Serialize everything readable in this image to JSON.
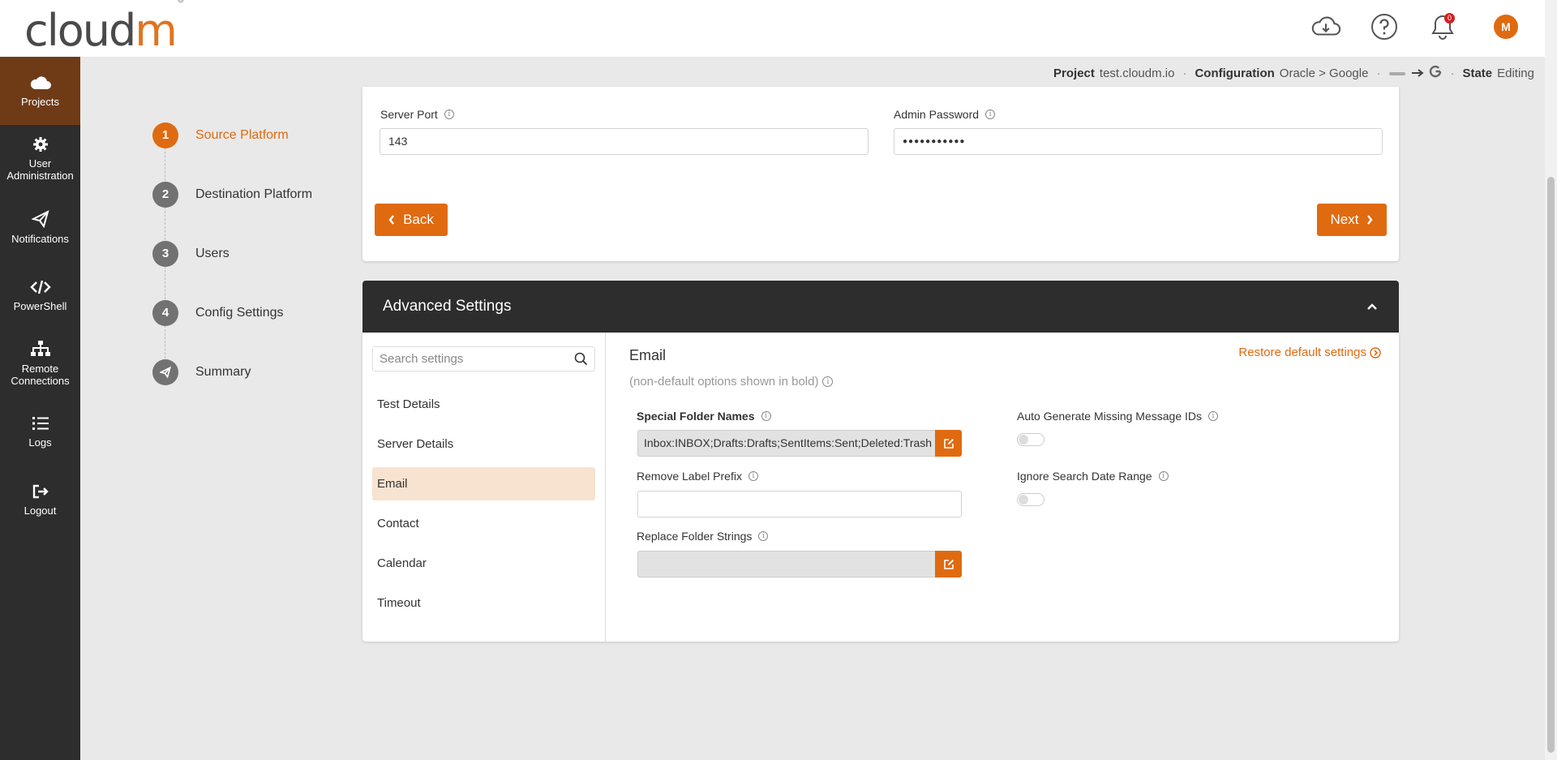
{
  "brand": {
    "logo_main": "cloud",
    "logo_accent": "m",
    "logo_mark": "®"
  },
  "topbar": {
    "notification_count": "0",
    "avatar_initial": "M"
  },
  "sidebar": {
    "items": [
      {
        "label": "Projects",
        "icon": "cloud-icon"
      },
      {
        "label": "User Administration",
        "icon": "gear-icon"
      },
      {
        "label": "Notifications",
        "icon": "paper-plane-icon"
      },
      {
        "label": "PowerShell",
        "icon": "code-icon"
      },
      {
        "label": "Remote Connections",
        "icon": "sitemap-icon"
      },
      {
        "label": "Logs",
        "icon": "list-icon"
      },
      {
        "label": "Logout",
        "icon": "logout-icon"
      }
    ]
  },
  "status": {
    "project_label": "Project",
    "project_value": "test.cloudm.io",
    "config_label": "Configuration",
    "config_value": "Oracle > Google",
    "state_label": "State",
    "state_value": "Editing"
  },
  "stepper": {
    "steps": [
      {
        "num": "1",
        "label": "Source Platform"
      },
      {
        "num": "2",
        "label": "Destination Platform"
      },
      {
        "num": "3",
        "label": "Users"
      },
      {
        "num": "4",
        "label": "Config Settings"
      },
      {
        "num": "",
        "label": "Summary"
      }
    ]
  },
  "server": {
    "port_label": "Server Port",
    "port_value": "143",
    "password_label": "Admin Password",
    "password_value": "●●●●●●●●●●●",
    "back_label": "Back",
    "next_label": "Next"
  },
  "advanced": {
    "title": "Advanced Settings",
    "search_placeholder": "Search settings",
    "categories": [
      "Test Details",
      "Server Details",
      "Email",
      "Contact",
      "Calendar",
      "Timeout"
    ],
    "active_category": "Email",
    "section_title": "Email",
    "restore_label": "Restore default settings",
    "note": "(non-default options shown in bold)",
    "special_folder_label": "Special Folder Names",
    "special_folder_value": "Inbox:INBOX;Drafts:Drafts;SentItems:Sent;Deleted:Trash",
    "remove_label_prefix_label": "Remove Label Prefix",
    "remove_label_prefix_value": "",
    "replace_folder_label": "Replace Folder Strings",
    "replace_folder_value": "",
    "auto_generate_label": "Auto Generate Missing Message IDs",
    "auto_generate_value": false,
    "ignore_search_label": "Ignore Search Date Range",
    "ignore_search_value": false
  },
  "colors": {
    "accent": "#e06a10",
    "sidebar": "#2d2d2d",
    "active_sidebar": "#6f3b17",
    "active_category": "#f8e2d0"
  }
}
